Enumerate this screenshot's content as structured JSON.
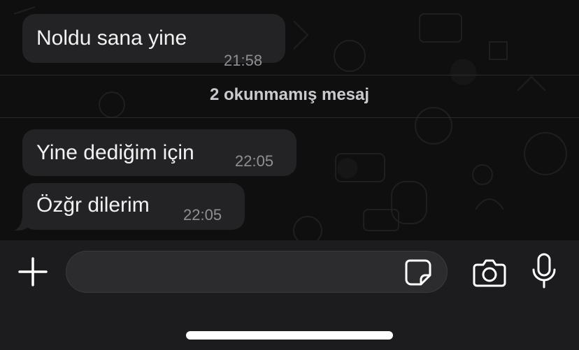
{
  "messages": [
    {
      "text": "Noldu sana yine",
      "time": "21:58"
    },
    {
      "text": "Yine dediğim için",
      "time": "22:05"
    },
    {
      "text": "Özğr dilerim",
      "time": "22:05"
    }
  ],
  "unread_divider": {
    "label": "2 okunmamış mesaj"
  },
  "composer": {
    "value": "",
    "placeholder": ""
  },
  "icons": {
    "attach": "plus-icon",
    "sticker": "sticker-icon",
    "camera": "camera-icon",
    "voice": "microphone-icon"
  },
  "colors": {
    "chat_background": "#0f0f0f",
    "bubble": "#232325",
    "time_text": "#8f8f94",
    "input_bar": "#1c1c1e"
  }
}
